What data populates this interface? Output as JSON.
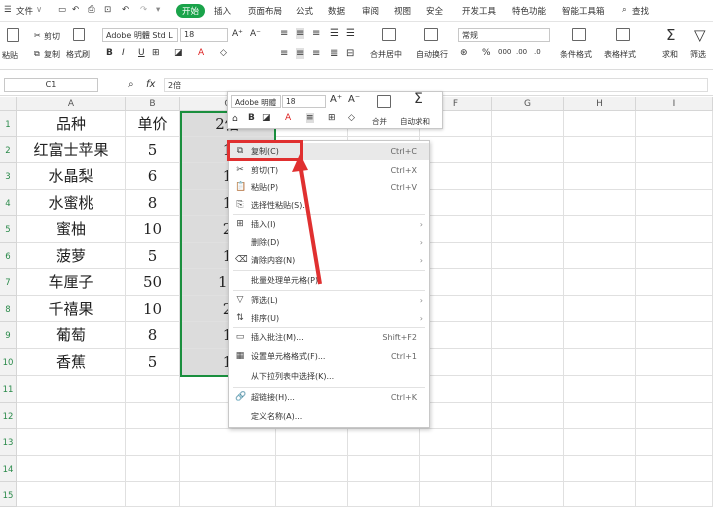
{
  "menubar": {
    "file": "文件",
    "tabs": [
      "开始",
      "插入",
      "页面布局",
      "公式",
      "数据",
      "审阅",
      "视图",
      "安全",
      "开发工具",
      "特色功能",
      "智能工具箱"
    ],
    "search": "查找"
  },
  "toolbar": {
    "paste": "粘贴",
    "cut": "剪切",
    "copy": "复制",
    "format_painter": "格式刷",
    "font_name": "Adobe 明體 Std L",
    "font_size": "18",
    "merge_center": "合并居中",
    "auto_wrap": "自动换行",
    "number_format": "常规",
    "cond_format": "条件格式",
    "table_style": "表格样式",
    "sum": "求和",
    "filter": "筛选"
  },
  "formula_bar": {
    "name_box": "C1",
    "fx": "fx",
    "value": "2倍"
  },
  "columns": [
    "A",
    "B",
    "C",
    "D",
    "E",
    "F",
    "G",
    "H",
    "I"
  ],
  "rows": [
    "1",
    "2",
    "3",
    "4",
    "5",
    "6",
    "7",
    "8",
    "9",
    "10",
    "11",
    "12",
    "13",
    "14",
    "15"
  ],
  "table": {
    "header": [
      "品种",
      "单价",
      "2倍"
    ],
    "data": [
      [
        "红富士苹果",
        "5",
        "1"
      ],
      [
        "水晶梨",
        "6",
        "1"
      ],
      [
        "水蜜桃",
        "8",
        "1"
      ],
      [
        "蜜柚",
        "10",
        "2"
      ],
      [
        "菠萝",
        "5",
        "1"
      ],
      [
        "车厘子",
        "50",
        "10"
      ],
      [
        "千禧果",
        "10",
        "2"
      ],
      [
        "葡萄",
        "8",
        "1"
      ],
      [
        "香蕉",
        "5",
        "1"
      ]
    ]
  },
  "mini_toolbar": {
    "font": "Adobe 明體",
    "size": "18",
    "merge": "合并",
    "autosum": "自动求和"
  },
  "context_menu": [
    {
      "label": "复制(C)",
      "shortcut": "Ctrl+C",
      "icon": "copy-icon",
      "glyph": "⧉"
    },
    {
      "label": "剪切(T)",
      "shortcut": "Ctrl+X",
      "icon": "scissors-icon",
      "glyph": "✂"
    },
    {
      "label": "粘贴(P)",
      "shortcut": "Ctrl+V",
      "icon": "paste-icon",
      "glyph": "📋"
    },
    {
      "label": "选择性粘贴(S)...",
      "shortcut": "",
      "icon": "paste-special-icon",
      "glyph": "⎘"
    },
    {
      "label": "插入(I)",
      "shortcut": "",
      "icon": "insert-icon",
      "glyph": "⊞",
      "arrow": true
    },
    {
      "label": "删除(D)",
      "shortcut": "",
      "icon": "",
      "glyph": "",
      "arrow": true
    },
    {
      "label": "清除内容(N)",
      "shortcut": "",
      "icon": "clear-icon",
      "glyph": "⌫",
      "arrow": true
    },
    {
      "label": "批量处理单元格(P)",
      "shortcut": "",
      "icon": "",
      "glyph": ""
    },
    {
      "label": "筛选(L)",
      "shortcut": "",
      "icon": "filter-icon",
      "glyph": "▽",
      "arrow": true
    },
    {
      "label": "排序(U)",
      "shortcut": "",
      "icon": "sort-icon",
      "glyph": "⇅",
      "arrow": true
    },
    {
      "label": "插入批注(M)...",
      "shortcut": "Shift+F2",
      "icon": "comment-icon",
      "glyph": "▭"
    },
    {
      "label": "设置单元格格式(F)...",
      "shortcut": "Ctrl+1",
      "icon": "format-cells-icon",
      "glyph": "▦"
    },
    {
      "label": "从下拉列表中选择(K)...",
      "shortcut": "",
      "icon": "",
      "glyph": ""
    },
    {
      "label": "超链接(H)...",
      "shortcut": "Ctrl+K",
      "icon": "link-icon",
      "glyph": "🔗"
    },
    {
      "label": "定义名称(A)...",
      "shortcut": "",
      "icon": "",
      "glyph": ""
    }
  ],
  "colors": {
    "accent_green": "#1aa34a",
    "highlight_red": "#e03030",
    "selection_gray": "#dcdcdc"
  }
}
